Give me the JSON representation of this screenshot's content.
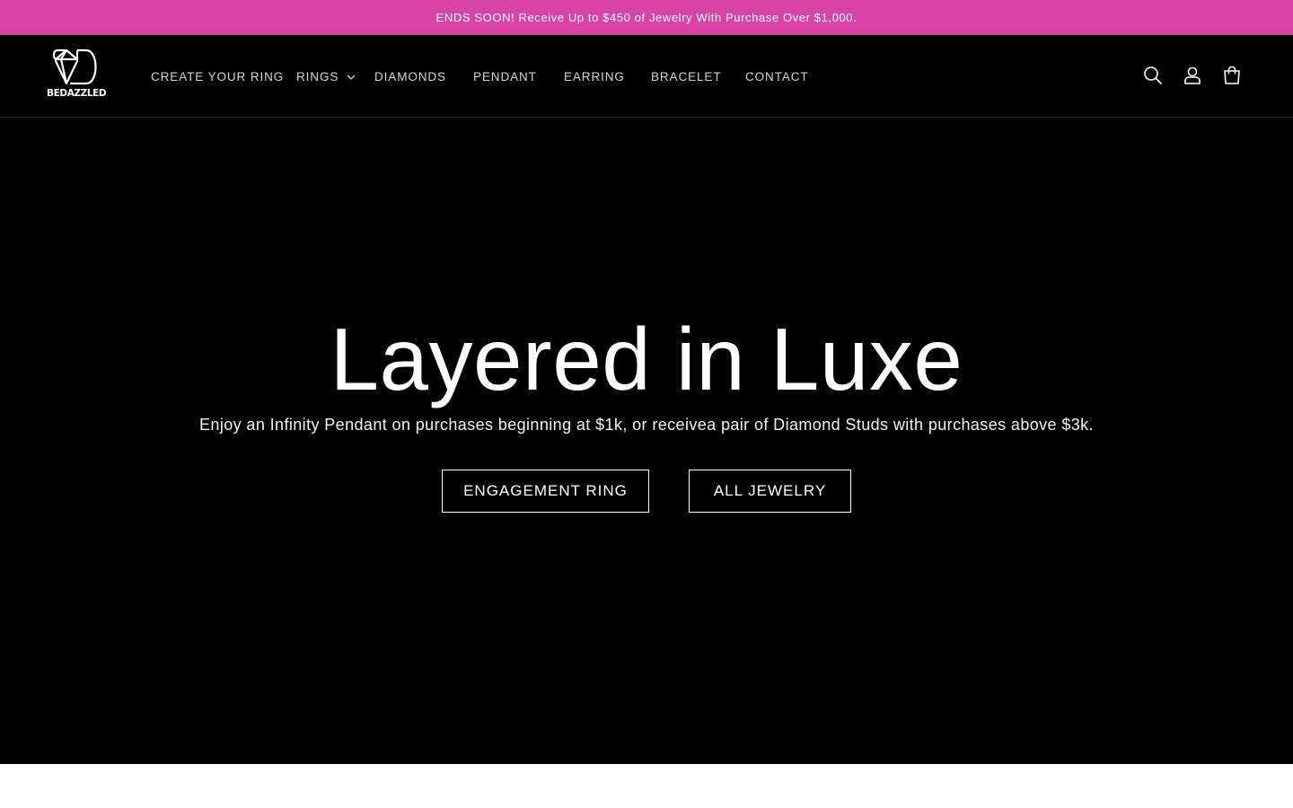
{
  "announcement": {
    "text": "ENDS SOON! Receive Up to $450 of Jewelry With Purchase Over $1,000.",
    "background": "#d843a8"
  },
  "header": {
    "logo": {
      "monogram": "BD",
      "text": "BEDAZZLED"
    },
    "nav": [
      {
        "label": "CREATE YOUR RING"
      },
      {
        "label": "RINGS",
        "has_dropdown": true,
        "icon": "chevron-down-icon"
      },
      {
        "label": "DIAMONDS"
      },
      {
        "label": "PENDANT"
      },
      {
        "label": "EARRING"
      },
      {
        "label": "BRACELET"
      },
      {
        "label": "CONTACT"
      }
    ],
    "icons": [
      "search-icon",
      "account-icon",
      "cart-icon"
    ]
  },
  "hero": {
    "title": "Layered in Luxe",
    "subtitle": "Enjoy an Infinity Pendant on purchases beginning at $1k, or receivea pair of Diamond Studs with purchases above $3k.",
    "buttons": {
      "engagement": "ENGAGEMENT RING",
      "jewelry": "ALL JEWELRY"
    },
    "background": "#000000"
  }
}
